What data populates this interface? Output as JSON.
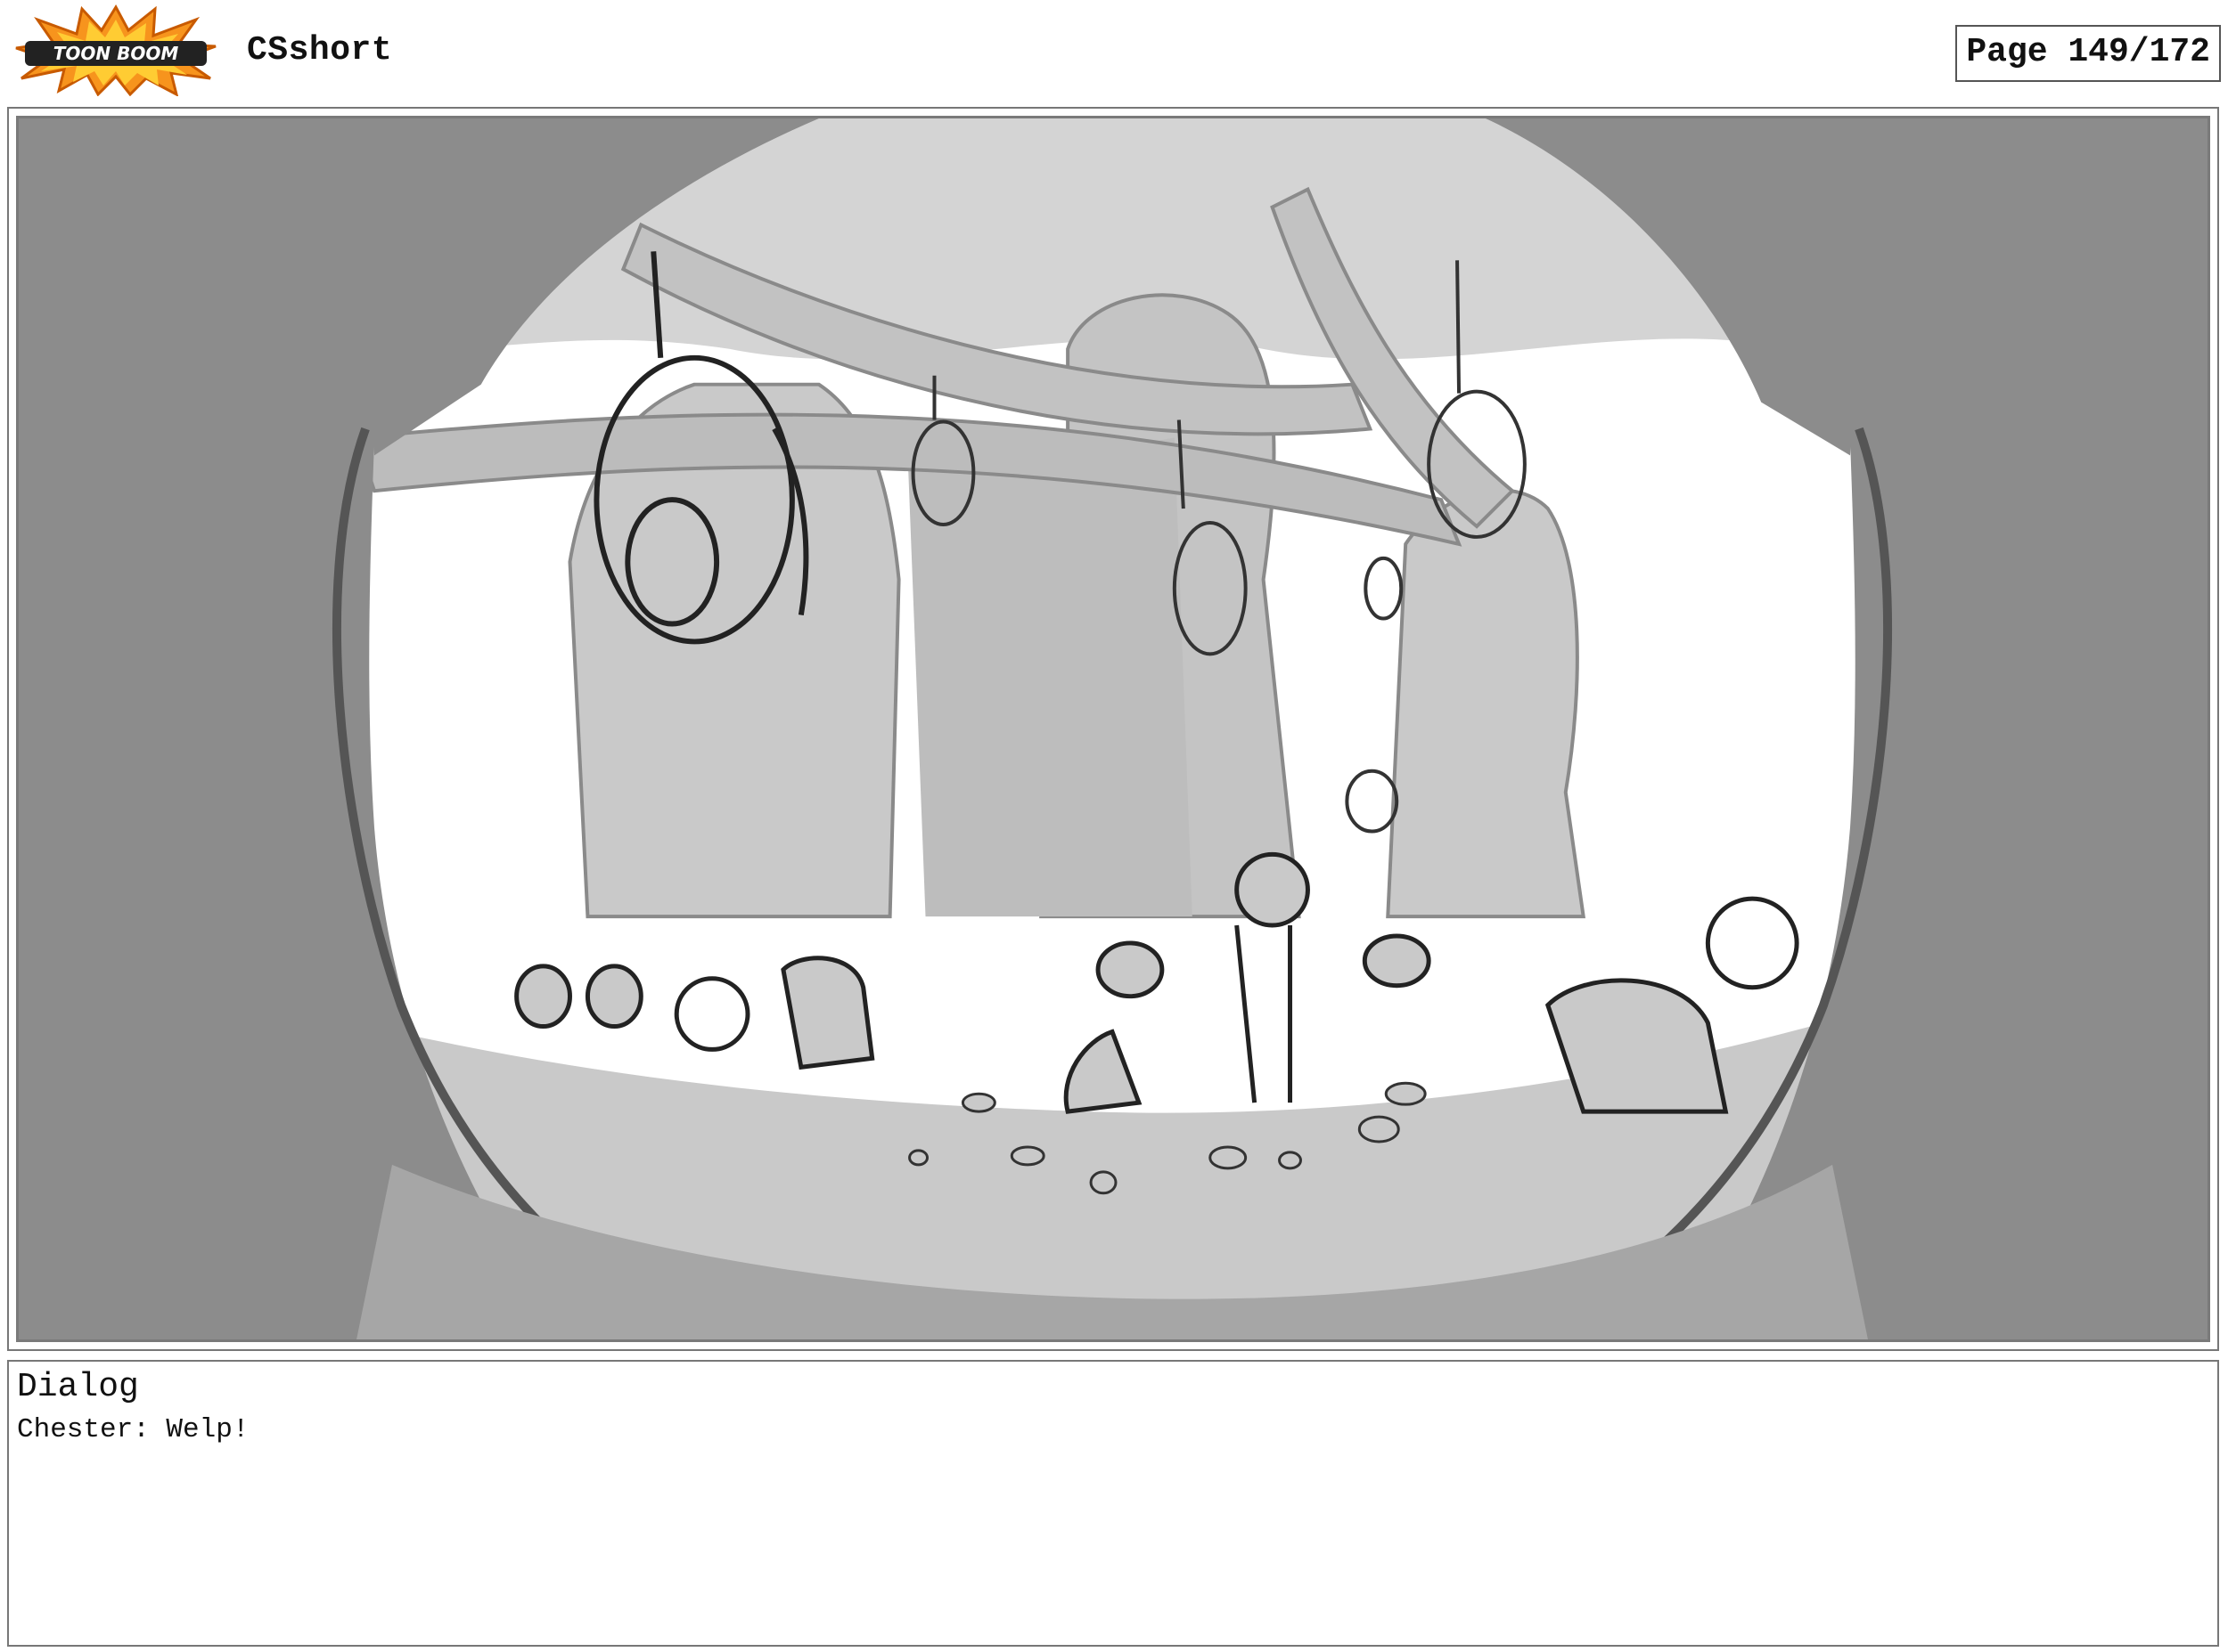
{
  "header": {
    "logo_text": "TOON BOOM",
    "project_title": "CSshort",
    "page_counter": "Page 149/172"
  },
  "panel": {
    "image_description_icon": "storyboard-sketch"
  },
  "dialog": {
    "heading": "Dialog",
    "line": "Chester: Welp!"
  }
}
